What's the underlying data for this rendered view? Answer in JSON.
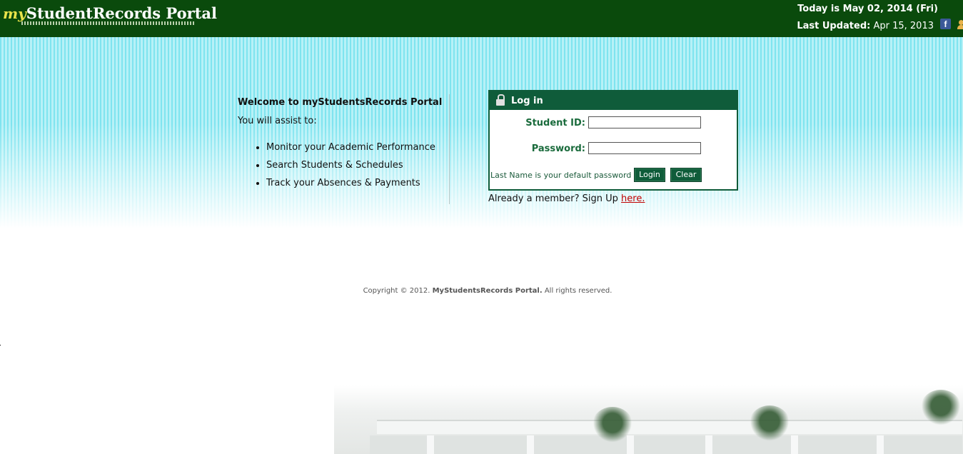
{
  "header": {
    "logo_prefix": "my",
    "logo_main": "StudentRecords Portal",
    "today": "Today is May 02, 2014 (Fri)",
    "last_updated_label": "Last Updated:",
    "last_updated_value": "Apr 15, 2013",
    "facebook_glyph": "f",
    "icons": [
      "facebook-icon",
      "user-icon"
    ]
  },
  "welcome": {
    "title": "Welcome to myStudentsRecords Portal",
    "subtitle": "You will assist to:",
    "items": [
      "Monitor your Academic Performance",
      "Search Students & Schedules",
      "Track your Absences & Payments"
    ]
  },
  "login": {
    "title": "Log in",
    "student_id_label": "Student ID:",
    "student_id_value": "",
    "password_label": "Password:",
    "password_value": "",
    "hint": "Last Name is your default password",
    "login_button": "Login",
    "clear_button": "Clear"
  },
  "signup": {
    "text": "Already a member? Sign Up ",
    "link": "here."
  },
  "footer": {
    "prefix": "Copyright © 2012. ",
    "name": "MyStudentsRecords Portal.",
    "suffix": " All rights reserved."
  },
  "colors": {
    "header_bg": "#0a4a0c",
    "accent_green": "#0f5c3a",
    "link_red": "#c00000",
    "banner_stripe": "#7fe4ef"
  }
}
